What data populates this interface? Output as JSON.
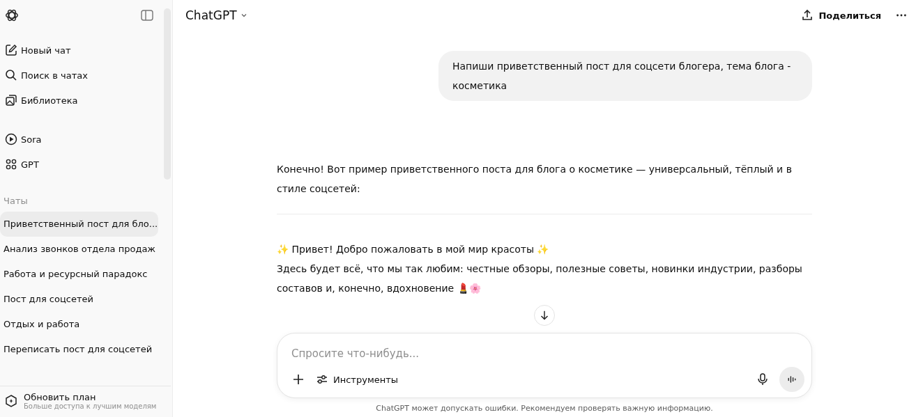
{
  "sidebar": {
    "nav": [
      {
        "kind": "new",
        "label": "Новый чат"
      },
      {
        "kind": "search",
        "label": "Поиск в чатах"
      },
      {
        "kind": "library",
        "label": "Библиотека"
      }
    ],
    "apps": [
      {
        "kind": "play",
        "label": "Sora"
      },
      {
        "kind": "grid",
        "label": "GPT"
      }
    ],
    "chats_heading": "Чаты",
    "chats": [
      {
        "label": "Приветственный пост для бло...",
        "selected": true
      },
      {
        "label": "Анализ звонков отдела продаж",
        "selected": false
      },
      {
        "label": "Работа и ресурсный парадокс",
        "selected": false
      },
      {
        "label": "Пост для соцсетей",
        "selected": false
      },
      {
        "label": "Отдых и работа",
        "selected": false
      },
      {
        "label": "Переписать пост для соцсетей",
        "selected": false
      }
    ],
    "upgrade": {
      "title": "Обновить план",
      "subtitle": "Больше доступа к лучшим моделям"
    }
  },
  "header": {
    "model": "ChatGPT",
    "share": "Поделиться"
  },
  "messages": [
    {
      "kind": "user",
      "text": "Напиши приветственный пост для соцсети блогера, тема блога - косметика"
    },
    {
      "kind": "assistant",
      "paragraphs": [
        "Конечно! Вот пример приветственного поста для блога о косметике — универсальный, тёплый и в стиле соцсетей:"
      ]
    },
    {
      "kind": "rule"
    },
    {
      "kind": "assistant",
      "paragraphs": [
        "✨ Привет! Добро пожаловать в мой мир красоты ✨",
        "Здесь будет всё, что мы так любим: честные обзоры, полезные советы, новинки индустрии, разборы составов и, конечно, вдохновение 💄🌸"
      ]
    }
  ],
  "composer": {
    "placeholder": "Спросите что-нибудь...",
    "tools": "Инструменты"
  },
  "disclaimer": "ChatGPT может допускать ошибки. Рекомендуем проверять важную информацию."
}
